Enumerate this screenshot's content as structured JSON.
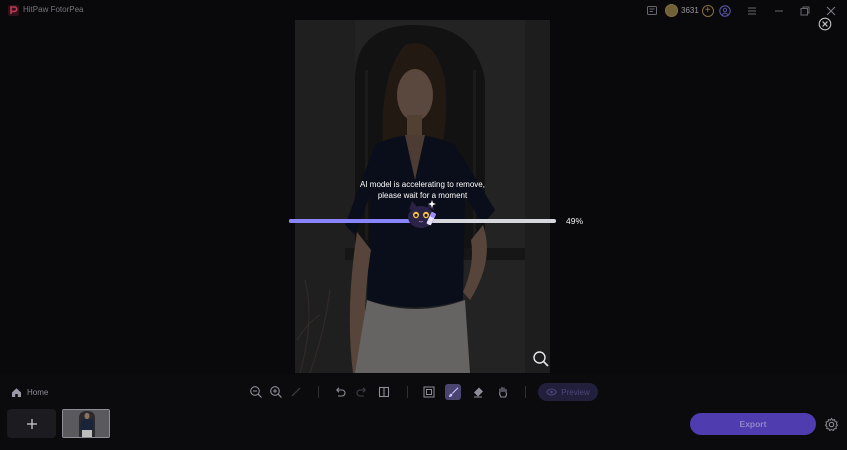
{
  "window": {
    "app_title": "HitPaw FotorPea",
    "coin_count": "3631",
    "icons": [
      "app-logo-icon",
      "feedback-icon",
      "coin-icon",
      "add-coins-icon",
      "account-icon",
      "menu-icon",
      "minimize-icon",
      "restore-icon",
      "close-icon"
    ]
  },
  "processing": {
    "message_line1": "AI model is accelerating to remove,",
    "message_line2": "please wait for a moment",
    "progress_percent_label": "49%",
    "progress_fraction": 0.49,
    "accent_color": "#8b84ff"
  },
  "bottom_bar": {
    "home_label": "Home",
    "preview_label": "Preview",
    "export_label": "Export",
    "add_label": "+",
    "tools": [
      "zoom-out",
      "zoom-in",
      "pen",
      "undo",
      "redo",
      "compare",
      "frame",
      "brush",
      "eraser",
      "hand"
    ],
    "active_tool": "brush"
  }
}
